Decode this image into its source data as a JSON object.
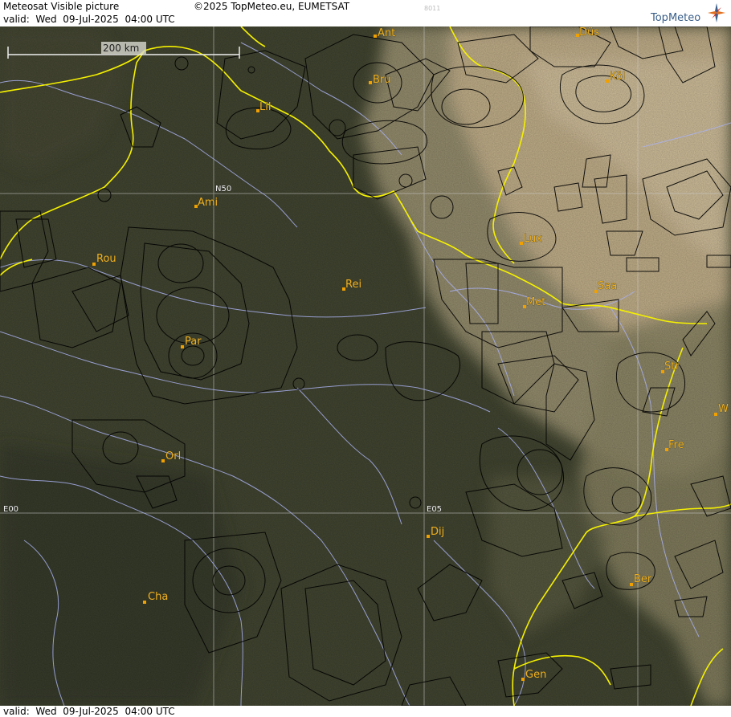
{
  "header": {
    "title": "Meteosat Visible picture",
    "copyright": "©2025 TopMeteo.eu, EUMETSAT",
    "valid": "valid:  Wed  09-Jul-2025  04:00 UTC",
    "code": "8011",
    "brand": "TopMeteo",
    "brand_icon": "compass-star-icon"
  },
  "footer": {
    "valid": "valid:  Wed  09-Jul-2025  04:00 UTC"
  },
  "map": {
    "scale_label": "200 km",
    "grid_labels": {
      "lat_n50": "N50",
      "lon_e00": "E00",
      "lon_e05": "E05"
    },
    "cities": [
      "Ant",
      "Düs",
      "Bru",
      "Köl",
      "Lil",
      "Ami",
      "Rou",
      "Lux",
      "Rei",
      "Saa",
      "Met",
      "Par",
      "Str",
      "W",
      "Fre",
      "Orl",
      "Dij",
      "Ber",
      "Cha",
      "Gen"
    ],
    "colors": {
      "border": "#f5f000",
      "river": "#a9b0ee",
      "airspace": "#000000",
      "grid": "#c8c8c8",
      "city_dot": "#f0a000",
      "ground_dark": "#3e432c",
      "cloud": "#d8c49c"
    }
  }
}
